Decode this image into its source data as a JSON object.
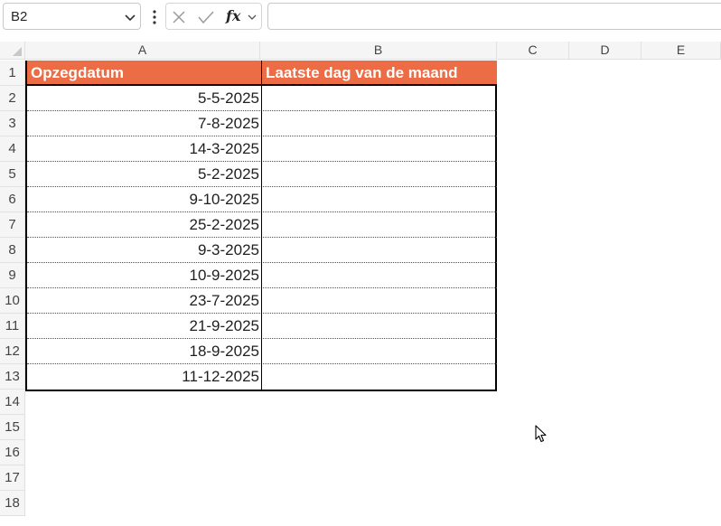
{
  "formula_bar": {
    "name_box": "B2",
    "fx_label": "fx",
    "formula": ""
  },
  "columns": [
    "A",
    "B",
    "C",
    "D",
    "E"
  ],
  "rows": [
    "1",
    "2",
    "3",
    "4",
    "5",
    "6",
    "7",
    "8",
    "9",
    "10",
    "11",
    "12",
    "13",
    "14",
    "15",
    "16",
    "17",
    "18"
  ],
  "table": {
    "headers": [
      "Opzegdatum",
      "Laatste dag van de maand"
    ],
    "header_color": "#ec6d45",
    "opzegdatum": [
      "5-5-2025",
      "7-8-2025",
      "14-3-2025",
      "5-2-2025",
      "9-10-2025",
      "25-2-2025",
      "9-3-2025",
      "10-9-2025",
      "23-7-2025",
      "21-9-2025",
      "18-9-2025",
      "11-12-2025"
    ],
    "laatste_dag": [
      "",
      "",
      "",
      "",
      "",
      "",
      "",
      "",
      "",
      "",
      "",
      ""
    ]
  }
}
